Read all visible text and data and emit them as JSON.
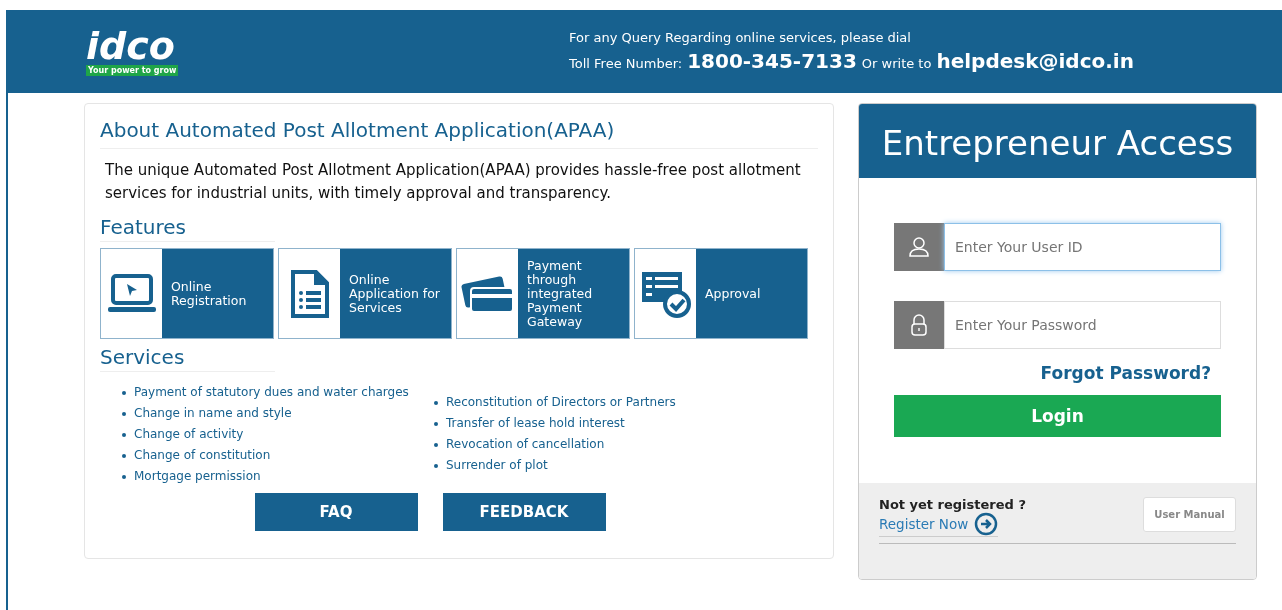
{
  "header": {
    "logo": "idco",
    "tagline": "Your power to grow",
    "query_line": "For any Query Regarding online services, please dial",
    "toll_label": "Toll Free Number:",
    "toll_number": "1800-345-7133",
    "write_label": "Or write to",
    "email": "helpdesk@idco.in"
  },
  "about": {
    "title": "About Automated Post Allotment Application(APAA)",
    "text": "The unique Automated Post Allotment Application(APAA) provides hassle-free post allotment services for industrial units, with timely approval and transparency."
  },
  "features": {
    "title": "Features",
    "items": [
      {
        "kind": "laptop",
        "label": "Online Registration"
      },
      {
        "kind": "document",
        "label": "Online Application for Services"
      },
      {
        "kind": "cards",
        "label": "Payment through integrated Payment Gateway"
      },
      {
        "kind": "approval",
        "label": "Approval"
      }
    ]
  },
  "services": {
    "title": "Services",
    "column_1": [
      "Payment of statutory dues and water charges",
      "Change in name and style",
      "Change of activity",
      "Change of constitution",
      "Mortgage permission"
    ],
    "column_2": [
      "Reconstitution of Directors or Partners",
      "Transfer of lease hold interest",
      "Revocation of cancellation",
      "Surrender of plot"
    ]
  },
  "buttons": [
    "FAQ",
    "FEEDBACK"
  ],
  "login": {
    "title": "Entrepreneur Access",
    "fields": [
      {
        "kind": "user",
        "placeholder": "Enter Your User ID",
        "focused": true
      },
      {
        "kind": "lock",
        "placeholder": "Enter Your Password",
        "focused": false
      }
    ],
    "forgot": "Forgot Password?",
    "submit": "Login",
    "not_registered": "Not yet registered ?",
    "register": "Register Now",
    "manual": "User Manual"
  }
}
